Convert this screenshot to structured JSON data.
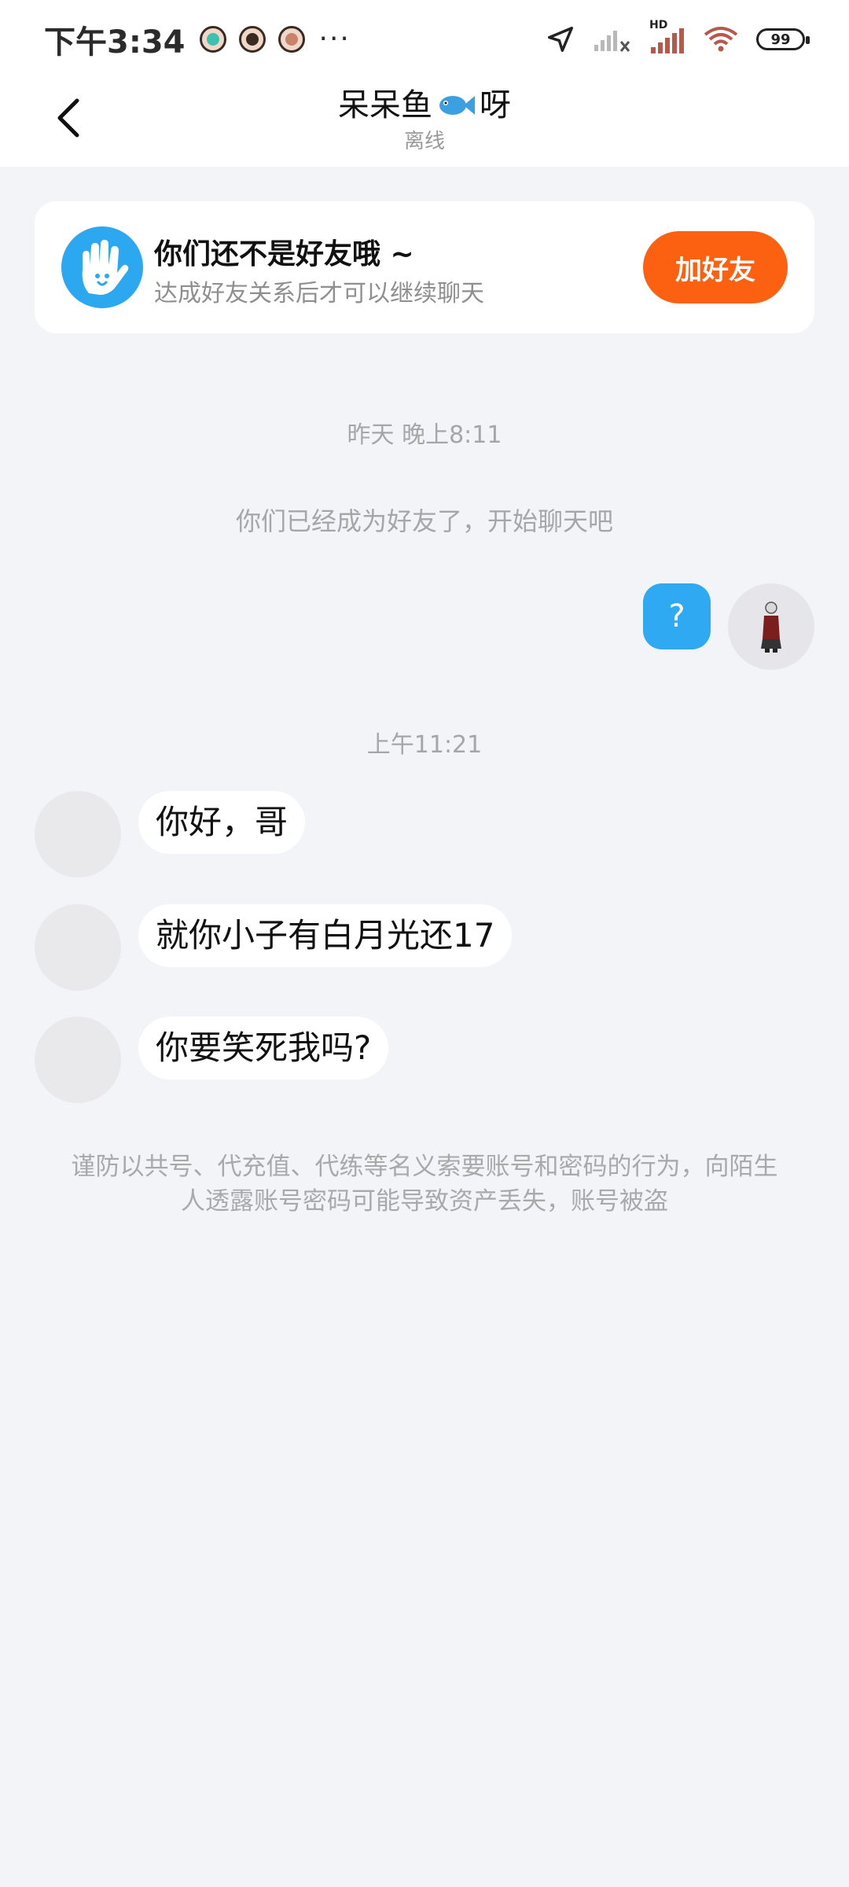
{
  "status_bar": {
    "time": "下午3:34",
    "battery": "99",
    "network": "HD"
  },
  "header": {
    "title_prefix": "呆呆鱼",
    "title_suffix": "呀",
    "status": "离线"
  },
  "friend_card": {
    "title": "你们还不是好友哦 ~",
    "subtitle": "达成好友关系后才可以继续聊天",
    "button": "加好友"
  },
  "chat": {
    "timestamp1": "昨天 晚上8:11",
    "system_msg": "你们已经成为好友了，开始聊天吧",
    "my_message": "?",
    "timestamp2": "上午11:21",
    "messages": [
      "你好，哥",
      "就你小子有白月光还17",
      "你要笑死我吗?"
    ],
    "warning": "谨防以共号、代充值、代练等名义索要账号和密码的行为，向陌生人透露账号密码可能导致资产丢失，账号被盗"
  },
  "colors": {
    "accent_blue": "#2ea9f2",
    "add_button": "#fb6110",
    "background": "#f2f4f8"
  }
}
